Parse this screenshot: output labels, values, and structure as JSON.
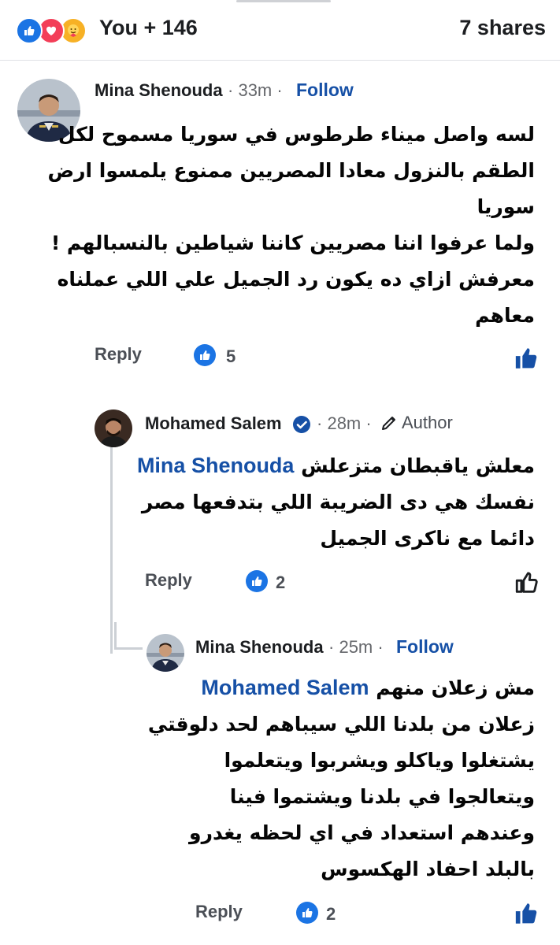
{
  "reactions": {
    "icons": [
      "like-icon",
      "love-icon",
      "care-icon"
    ],
    "count_text": "You + 146",
    "shares_text": "7 shares"
  },
  "comments": [
    {
      "author": "Mina Shenouda",
      "time": "33m",
      "action": "Follow",
      "lines": [
        "لسه واصل ميناء طرطوس في سوريا مسموح لكل",
        "الطقم بالنزول معادا المصريين ممنوع يلمسوا ارض",
        "سوريا",
        "ولما عرفوا اننا مصريين كاننا شياطين بالنسبالهم !",
        "معرفش ازاي ده يكون رد الجميل علي اللي عملناه",
        "معاهم"
      ],
      "reply_label": "Reply",
      "like_count": "5"
    },
    {
      "author": "Mohamed Salem",
      "time": "28m",
      "badge": "Author",
      "mention": "Mina Shenouda",
      "lines": [
        "معلش ياقبطان متزعلش",
        "نفسك  هي دى الضريبة اللي بتدفعها مصر",
        "دائما مع ناكرى الجميل"
      ],
      "reply_label": "Reply",
      "like_count": "2"
    },
    {
      "author": "Mina Shenouda",
      "time": "25m",
      "action": "Follow",
      "mention": "Mohamed Salem",
      "lines": [
        "مش زعلان منهم",
        "زعلان من بلدنا اللي سيباهم لحد دلوقتي",
        "يشتغلوا وياكلو ويشربوا ويتعلموا",
        "ويتعالجوا في بلدنا ويشتموا فينا",
        "وعندهم استعداد في اي لحظه يغدرو",
        "بالبلد احفاد الهكسوس"
      ],
      "reply_label": "Reply",
      "like_count": "2"
    }
  ],
  "colors": {
    "like_blue": "#1b74e4",
    "love_red": "#f33e58",
    "care_yellow": "#f7b125",
    "mention_blue": "#1650a6",
    "meta_gray": "#65676b"
  }
}
